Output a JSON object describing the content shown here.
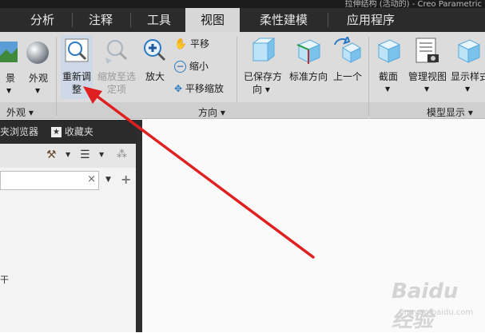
{
  "title": "拉伸结构 (活动的) - Creo Parametric",
  "tabs": [
    {
      "label": "分析"
    },
    {
      "label": "注释"
    },
    {
      "label": "工具"
    },
    {
      "label": "视图",
      "active": true
    },
    {
      "label": "柔性建模"
    },
    {
      "label": "应用程序"
    }
  ],
  "ribbon": {
    "appearance": {
      "scene_label": "景",
      "appearance_label": "外观",
      "group_label": "外观"
    },
    "orientation": {
      "refit_label": "重新调整",
      "zoom_selected_label": "缩放至选定项",
      "zoom_in_label": "放大",
      "pan_label": "平移",
      "zoom_out_label": "缩小",
      "pan_zoom_label": "平移缩放",
      "saved_orientations_label": "已保存方向",
      "standard_orientation_label": "标准方向",
      "previous_label": "上一个",
      "group_label": "方向"
    },
    "model_display": {
      "section_label": "截面",
      "manage_views_label": "管理视图",
      "display_style_label": "显示样式",
      "group_label": "模型显示"
    }
  },
  "left_panel": {
    "tabs": [
      {
        "label": "夹浏览器"
      },
      {
        "label": "收藏夹"
      }
    ],
    "side_text": "干"
  },
  "watermark": {
    "text": "Baidu 经验",
    "sub": "jingyan.baidu.com"
  },
  "colors": {
    "arrow": "#e02020",
    "tabbar": "#2b2b2b",
    "ribbon": "#dcdcdc",
    "active_tab": "#d7d7d7"
  }
}
